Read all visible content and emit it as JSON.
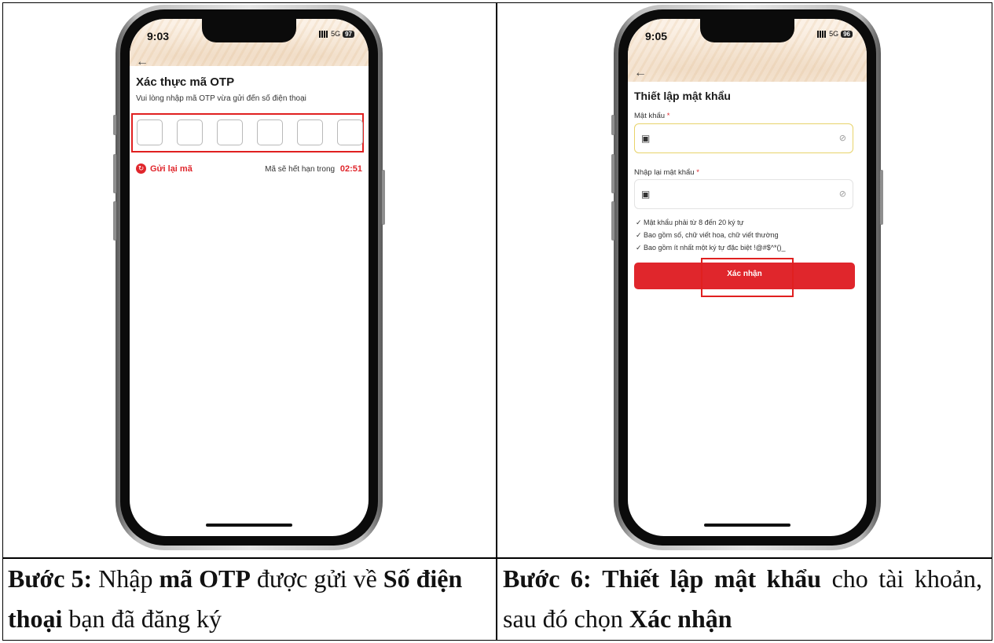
{
  "left_phone": {
    "time": "9:03",
    "network": "5G",
    "battery": "97",
    "title": "Xác thực mã OTP",
    "subtitle": "Vui lòng nhập mã OTP vừa gửi đến số điện thoại",
    "resend_label": "Gửi lại mã",
    "expire_label": "Mã sẽ hết hạn trong",
    "countdown": "02:51"
  },
  "right_phone": {
    "time": "9:05",
    "network": "5G",
    "battery": "96",
    "title": "Thiết lập mật khẩu",
    "password_label": "Mật khẩu",
    "confirm_password_label": "Nhập lại mật khẩu",
    "required_mark": "*",
    "rules": [
      "Mật khẩu phải từ 8 đến 20 ký tự",
      "Bao gồm số, chữ viết hoa, chữ viết thường",
      "Bao gồm ít nhất một ký tự đặc biệt !@#$^*()_"
    ],
    "confirm_button": "Xác nhận"
  },
  "captions": {
    "step5_label": "Bước 5:",
    "step5_t1": "Nhập",
    "step5_b1": "mã OTP",
    "step5_t2": "được gửi về",
    "step5_b2": "Số điện thoại",
    "step5_t3": "bạn đã đăng ký",
    "step6_label": "Bước 6:",
    "step6_b1": "Thiết lập mật khẩu",
    "step6_t1": "cho tài khoản, sau đó chọn",
    "step6_b2": "Xác nhận"
  },
  "colors": {
    "accent": "#e0262c",
    "highlight": "#e02020"
  }
}
